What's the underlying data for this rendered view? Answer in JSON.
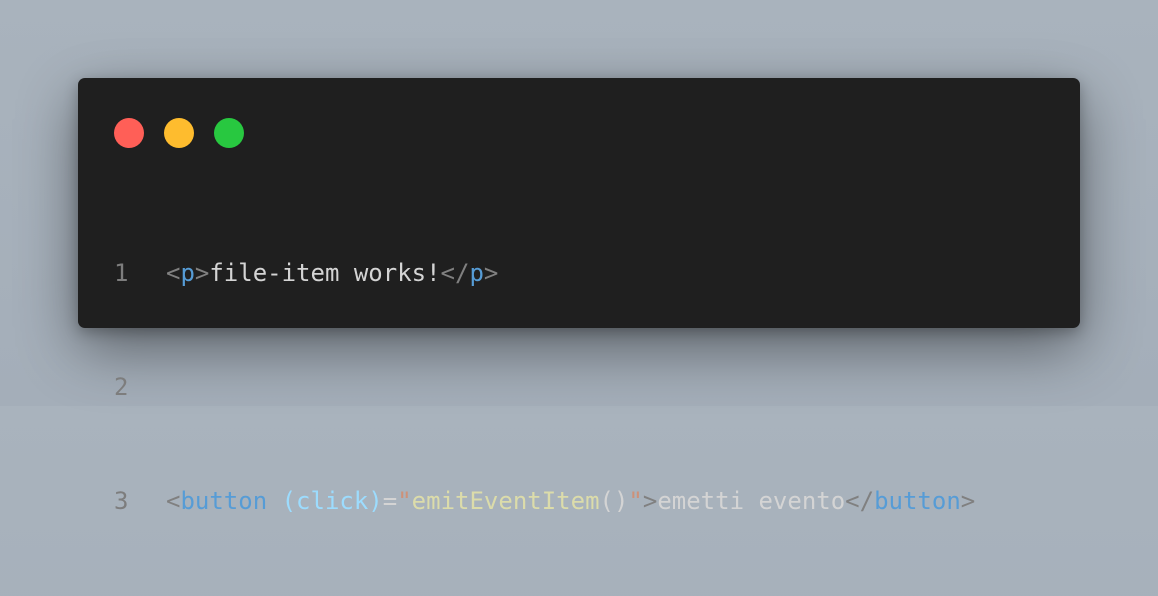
{
  "window": {
    "controls": [
      {
        "name": "close-dot",
        "color": "#ff5f57"
      },
      {
        "name": "minimize-dot",
        "color": "#febc2e"
      },
      {
        "name": "zoom-dot",
        "color": "#28c840"
      }
    ]
  },
  "colors": {
    "background": "#a9b3bd",
    "editor_bg": "#1f1f1f",
    "line_number": "#7d7d7d",
    "punctuation": "#808080",
    "tag": "#569cd6",
    "text": "#d4d4d4",
    "attribute": "#9cdcfe",
    "string": "#ce9178",
    "function": "#dcdcaa"
  },
  "code": {
    "lines": [
      {
        "number": "1",
        "tokens": [
          {
            "text": "<",
            "kind": "punct"
          },
          {
            "text": "p",
            "kind": "tag"
          },
          {
            "text": ">",
            "kind": "punct"
          },
          {
            "text": "file-item works!",
            "kind": "text"
          },
          {
            "text": "</",
            "kind": "punct"
          },
          {
            "text": "p",
            "kind": "tag"
          },
          {
            "text": ">",
            "kind": "punct"
          }
        ]
      },
      {
        "number": "2",
        "tokens": []
      },
      {
        "number": "3",
        "tokens": [
          {
            "text": "<",
            "kind": "punct"
          },
          {
            "text": "button",
            "kind": "tag"
          },
          {
            "text": " ",
            "kind": "text"
          },
          {
            "text": "(click)",
            "kind": "attr"
          },
          {
            "text": "=",
            "kind": "text"
          },
          {
            "text": "\"",
            "kind": "str"
          },
          {
            "text": "emitEventItem",
            "kind": "fn"
          },
          {
            "text": "()",
            "kind": "text"
          },
          {
            "text": "\"",
            "kind": "str"
          },
          {
            "text": ">",
            "kind": "punct"
          },
          {
            "text": "emetti evento",
            "kind": "text"
          },
          {
            "text": "</",
            "kind": "punct"
          },
          {
            "text": "button",
            "kind": "tag"
          },
          {
            "text": ">",
            "kind": "punct"
          }
        ]
      }
    ]
  }
}
